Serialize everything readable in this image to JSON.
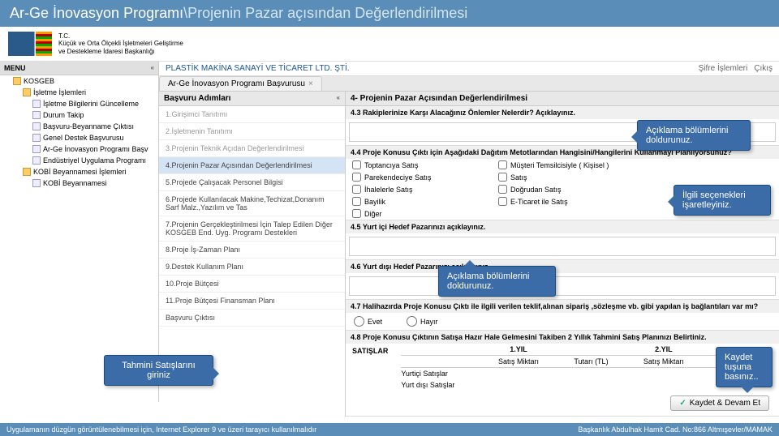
{
  "title": {
    "main": "Ar-Ge İnovasyon Programı",
    "sep": "\\",
    "sub": "Projenin Pazar açısından Değerlendirilmesi"
  },
  "org": {
    "tc": "T.C.",
    "line1": "Küçük ve Orta Ölçekli İşletmeleri Geliştirme",
    "line2": "ve Destekleme İdaresi Başkanlığı",
    "brand": "KOSGEB"
  },
  "menu": {
    "title": "MENU",
    "items": [
      {
        "label": "KOSGEB",
        "type": "folder",
        "lvl": 0
      },
      {
        "label": "İşletme İşlemleri",
        "type": "folder",
        "lvl": 1
      },
      {
        "label": "İşletme Bilgilerini Güncelleme",
        "type": "file",
        "lvl": 2
      },
      {
        "label": "Durum Takip",
        "type": "file",
        "lvl": 2
      },
      {
        "label": "Başvuru-Beyanname Çıktısı",
        "type": "file",
        "lvl": 2
      },
      {
        "label": "Genel Destek Başvurusu",
        "type": "file",
        "lvl": 2
      },
      {
        "label": "Ar-Ge İnovasyon Programı Başv",
        "type": "file",
        "lvl": 2
      },
      {
        "label": "Endüstriyel Uygulama Programı",
        "type": "file",
        "lvl": 2
      },
      {
        "label": "KOBİ Beyannamesi İşlemleri",
        "type": "folder",
        "lvl": 1
      },
      {
        "label": "KOBİ Beyannamesi",
        "type": "file",
        "lvl": 2
      }
    ]
  },
  "company": "PLASTİK MAKİNA SANAYİ VE TİCARET LTD. ŞTİ.",
  "toplinks": {
    "pass": "Şifre İşlemleri",
    "exit": "Çıkış"
  },
  "tab": "Ar-Ge İnovasyon Programı Başvurusu",
  "steps": {
    "title": "Başvuru Adımları",
    "list": [
      "1.Girişimci Tanıtımı",
      "2.İşletmenin Tanıtımı",
      "3.Projenin Teknik Açıdan Değerlendirilmesi",
      "4.Projenin Pazar Açısından Değerlendirilmesi",
      "5.Projede Çalışacak Personel Bilgisi",
      "6.Projede Kullanılacak Makine,Techizat,Donanım Sarf Malz.,Yazılım ve Tas",
      "7.Projenin Gerçekleştirilmesi İçin Talep Edilen Diğer KOSGEB End. Uyg. Programı Destekleri",
      "8.Proje İş-Zaman Planı",
      "9.Destek Kullanım Planı",
      "10.Proje Bütçesi",
      "11.Proje Bütçesi Finansman Planı",
      "Başvuru Çıktısı"
    ]
  },
  "form": {
    "title": "4- Projenin Pazar Açısından Değerlendirilmesi",
    "s43": "4.3 Rakiplerinize Karşı Alacağınız Önlemler Nelerdir? Açıklayınız.",
    "s44": "4.4 Proje Konusu Çıktı için Aşağıdaki Dağıtım Metotlarından Hangisini/Hangilerini Kullanmayı Planlıyorsunuz?",
    "opts": [
      "Toptancıya Satış",
      "Müşteri Temsilcisiyle ( Kişisel )",
      "Parekendeciye Satış",
      "Satış",
      "İhalelerle Satış",
      "Doğrudan Satış",
      "Bayilik",
      "E-Ticaret ile Satış",
      "Diğer"
    ],
    "s45": "4.5 Yurt içi Hedef Pazarınızı açıklayınız.",
    "s46": "4.6 Yurt dışı Hedef Pazarınızı açıklayınız.",
    "s47": "4.7 Halihazırda Proje Konusu Çıktı ile ilgili verilen teklif,alınan sipariş ,sözleşme vb. gibi yapılan iş bağlantıları var mı?",
    "r_yes": "Evet",
    "r_no": "Hayır",
    "s48": "4.8 Proje Konusu Çıktının Satışa Hazır Hale Gelmesini Takiben 2 Yıllık Tahmini Satış Planınızı Belirtiniz.",
    "sales_label": "SATIŞLAR",
    "y1": "1.YIL",
    "y2": "2.YIL",
    "col_m": "Satış Miktarı",
    "col_t": "Tutarı (TL)",
    "row1": "Yurtiçi Satışlar",
    "row2": "Yurt dışı Satışlar",
    "save": "Kaydet & Devam Et"
  },
  "callouts": {
    "c1": "Açıklama bölümlerini doldurunuz.",
    "c2": "İlgili seçenekleri işaretleyiniz.",
    "c3": "Açıklama bölümlerini doldurunuz.",
    "c4": "Tahmini Satışlarını giriniz",
    "c5": "Kaydet tuşuna basınız.."
  },
  "footer": {
    "left": "Uygulamanın düzgün görüntülenebilmesi için, Internet Explorer 9 ve üzeri tarayıcı kullanılmalıdır",
    "right": "Başkanlık Abdulhak Hamit Cad. No:866 Altmışevler/MAMAK"
  }
}
